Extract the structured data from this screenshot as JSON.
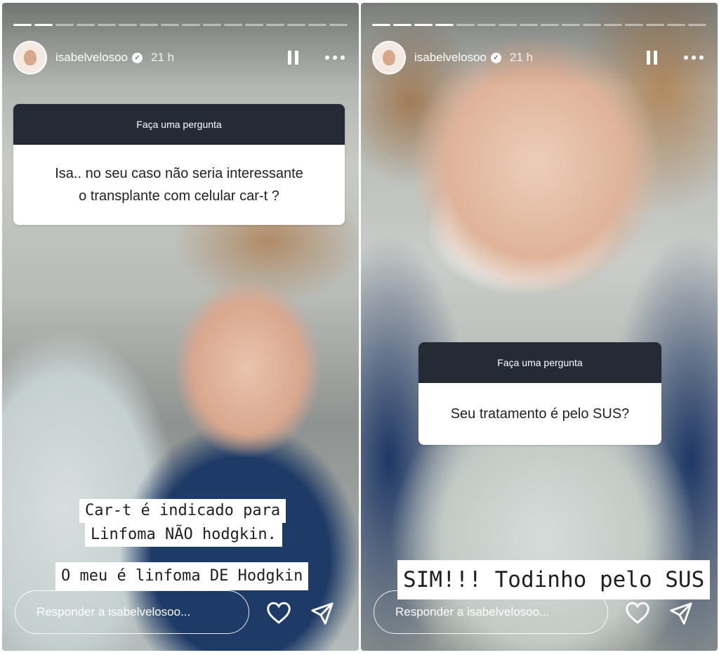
{
  "stories": [
    {
      "username": "isabelvelosoo",
      "time": "21 h",
      "question_header": "Faça uma pergunta",
      "question_line1": "Isa.. no seu caso não seria interessante",
      "question_line2": "o transplante com celular car-t ?",
      "caption1": "Car-t é indicado para",
      "caption2": "Linfoma NÃO hodgkin.",
      "caption3": "O meu é linfoma DE Hodgkin",
      "reply_placeholder": "Responder a isabelvelosoo..."
    },
    {
      "username": "isabelvelosoo",
      "time": "21 h",
      "question_header": "Faça uma pergunta",
      "question_text": "Seu tratamento é pelo SUS?",
      "caption": "SIM!!! Todinho pelo SUS",
      "reply_placeholder": "Responder a isabelvelosoo..."
    }
  ],
  "icons": [
    "pause-icon",
    "more-icon",
    "verified-icon",
    "heart-icon",
    "send-icon"
  ],
  "colors": {
    "question_header_bg": "#252b35",
    "caption_bg": "#ffffff",
    "caption_text": "#1f1f1f"
  }
}
